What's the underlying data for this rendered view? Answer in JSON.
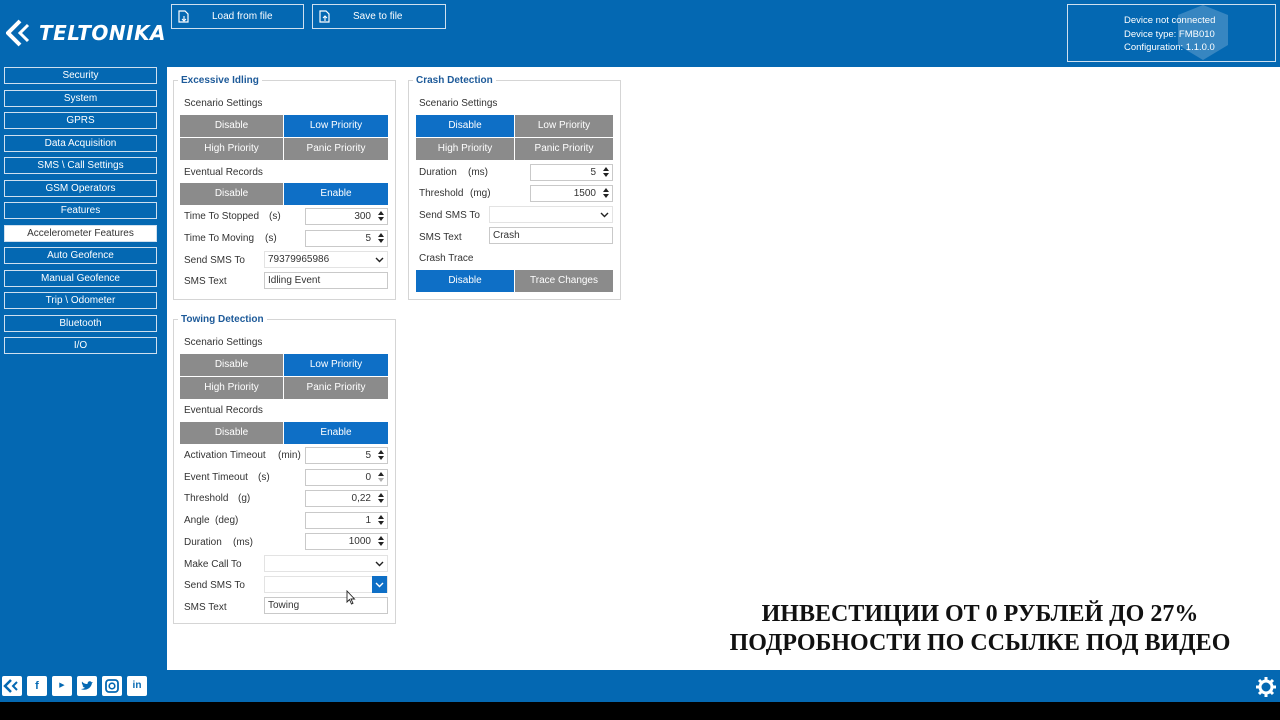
{
  "header": {
    "logo_text": "TELTONIKA",
    "load_button": "Load from file",
    "save_button": "Save to file",
    "device": {
      "status": "Device not connected",
      "type": "Device type: FMB010",
      "configuration": "Configuration: 1.1.0.0"
    }
  },
  "sidebar": {
    "items": [
      {
        "label": "Security"
      },
      {
        "label": "System"
      },
      {
        "label": "GPRS"
      },
      {
        "label": "Data Acquisition"
      },
      {
        "label": "SMS \\ Call Settings"
      },
      {
        "label": "GSM Operators"
      },
      {
        "label": "Features"
      },
      {
        "label": "Accelerometer Features",
        "active": true
      },
      {
        "label": "Auto Geofence"
      },
      {
        "label": "Manual Geofence"
      },
      {
        "label": "Trip \\ Odometer"
      },
      {
        "label": "Bluetooth"
      },
      {
        "label": "I/O"
      }
    ]
  },
  "excessive_idling": {
    "title": "Excessive Idling",
    "scenario_label": "Scenario Settings",
    "scenario_options": [
      "Disable",
      "Low Priority",
      "High Priority",
      "Panic Priority"
    ],
    "scenario_selected": "Low Priority",
    "eventual_label": "Eventual Records",
    "eventual_options": [
      "Disable",
      "Enable"
    ],
    "eventual_selected": "Enable",
    "time_to_stopped_label": "Time To Stopped",
    "time_to_stopped_unit": "(s)",
    "time_to_stopped_value": "300",
    "time_to_moving_label": "Time To Moving",
    "time_to_moving_unit": "(s)",
    "time_to_moving_value": "5",
    "send_sms_label": "Send SMS To",
    "send_sms_value": "79379965986",
    "sms_text_label": "SMS Text",
    "sms_text_value": "Idling Event"
  },
  "crash_detection": {
    "title": "Crash Detection",
    "scenario_label": "Scenario Settings",
    "scenario_options": [
      "Disable",
      "Low Priority",
      "High Priority",
      "Panic Priority"
    ],
    "scenario_selected": "Disable",
    "duration_label": "Duration",
    "duration_unit": "(ms)",
    "duration_value": "5",
    "threshold_label": "Threshold",
    "threshold_unit": "(mg)",
    "threshold_value": "1500",
    "send_sms_label": "Send SMS To",
    "send_sms_value": "",
    "sms_text_label": "SMS Text",
    "sms_text_value": "Crash",
    "crash_trace_label": "Crash Trace",
    "crash_trace_options": [
      "Disable",
      "Trace Changes"
    ],
    "crash_trace_selected": "Disable"
  },
  "towing_detection": {
    "title": "Towing Detection",
    "scenario_label": "Scenario Settings",
    "scenario_options": [
      "Disable",
      "Low Priority",
      "High Priority",
      "Panic Priority"
    ],
    "scenario_selected": "Low Priority",
    "eventual_label": "Eventual Records",
    "eventual_options": [
      "Disable",
      "Enable"
    ],
    "eventual_selected": "Enable",
    "activation_timeout_label": "Activation Timeout",
    "activation_timeout_unit": "(min)",
    "activation_timeout_value": "5",
    "event_timeout_label": "Event Timeout",
    "event_timeout_unit": "(s)",
    "event_timeout_value": "0",
    "threshold_label": "Threshold",
    "threshold_unit": "(g)",
    "threshold_value": "0,22",
    "angle_label": "Angle",
    "angle_unit": "(deg)",
    "angle_value": "1",
    "duration_label": "Duration",
    "duration_unit": "(ms)",
    "duration_value": "1000",
    "make_call_label": "Make Call To",
    "make_call_value": "",
    "send_sms_label": "Send SMS To",
    "send_sms_value": "",
    "sms_text_label": "SMS Text",
    "sms_text_value": "Towing"
  },
  "overlay": {
    "line1": "ИНВЕСТИЦИИ ОТ 0 РУБЛЕЙ ДО 27%",
    "line2": "ПОДРОБНОСТИ ПО ССЫЛКЕ ПОД ВИДЕО"
  },
  "footer": {
    "social": [
      "teltonika-icon",
      "facebook-icon",
      "youtube-icon",
      "twitter-icon",
      "instagram-icon",
      "linkedin-icon"
    ]
  },
  "colors": {
    "brand_blue": "#0468b2",
    "selected_blue": "#0e6fc6",
    "unselected_gray": "#8b8b8b",
    "legend_blue": "#1d5a99"
  }
}
